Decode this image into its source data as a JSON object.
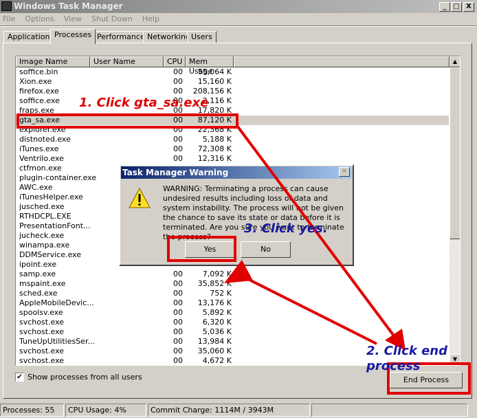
{
  "window": {
    "title": "Windows Task Manager",
    "minimize": "_",
    "maximize": "□",
    "close": "X"
  },
  "menu": [
    "File",
    "Options",
    "View",
    "Shut Down",
    "Help"
  ],
  "tabs": [
    {
      "label": "Applications"
    },
    {
      "label": "Processes",
      "active": true
    },
    {
      "label": "Performance"
    },
    {
      "label": "Networking"
    },
    {
      "label": "Users"
    }
  ],
  "columns": [
    "Image Name",
    "User Name",
    "CPU",
    "Mem Usage"
  ],
  "rows": [
    {
      "name": "soffice.bin",
      "cpu": "00",
      "mem": "55,064 K"
    },
    {
      "name": "Xion.exe",
      "cpu": "00",
      "mem": "15,160 K"
    },
    {
      "name": "firefox.exe",
      "cpu": "00",
      "mem": "208,156 K"
    },
    {
      "name": "soffice.exe",
      "cpu": "00",
      "mem": "2,116 K"
    },
    {
      "name": "fraps.exe",
      "cpu": "00",
      "mem": "17,820 K"
    },
    {
      "name": "gta_sa.exe",
      "cpu": "00",
      "mem": "87,120 K",
      "selected": true
    },
    {
      "name": "explorer.exe",
      "cpu": "00",
      "mem": "22,368 K"
    },
    {
      "name": "distnoted.exe",
      "cpu": "00",
      "mem": "5,188 K"
    },
    {
      "name": "iTunes.exe",
      "cpu": "00",
      "mem": "72,308 K"
    },
    {
      "name": "Ventrilo.exe",
      "cpu": "00",
      "mem": "12,316 K"
    },
    {
      "name": "ctfmon.exe"
    },
    {
      "name": "plugin-container.exe"
    },
    {
      "name": "AWC.exe"
    },
    {
      "name": "iTunesHelper.exe"
    },
    {
      "name": "jusched.exe"
    },
    {
      "name": "RTHDCPL.EXE"
    },
    {
      "name": "PresentationFont..."
    },
    {
      "name": "jucheck.exe"
    },
    {
      "name": "winampa.exe"
    },
    {
      "name": "DDMService.exe"
    },
    {
      "name": "ipoint.exe"
    },
    {
      "name": "samp.exe",
      "cpu": "00",
      "mem": "7,092 K"
    },
    {
      "name": "mspaint.exe",
      "cpu": "00",
      "mem": "35,852 K"
    },
    {
      "name": "sched.exe",
      "cpu": "00",
      "mem": "752 K"
    },
    {
      "name": "AppleMobileDevic...",
      "cpu": "00",
      "mem": "13,176 K"
    },
    {
      "name": "spoolsv.exe",
      "cpu": "00",
      "mem": "5,892 K"
    },
    {
      "name": "svchost.exe",
      "cpu": "00",
      "mem": "6,320 K"
    },
    {
      "name": "svchost.exe",
      "cpu": "00",
      "mem": "5,036 K"
    },
    {
      "name": "TuneUpUtilitiesSer...",
      "cpu": "00",
      "mem": "13,984 K"
    },
    {
      "name": "svchost.exe",
      "cpu": "00",
      "mem": "35,060 K"
    },
    {
      "name": "svchost.exe",
      "cpu": "00",
      "mem": "4,672 K"
    }
  ],
  "show_all_users": {
    "label": "Show processes from all users",
    "checked": true
  },
  "end_process_label": "End Process",
  "status": {
    "processes": "Processes: 55",
    "cpu": "CPU Usage: 4%",
    "commit": "Commit Charge: 1114M / 3943M"
  },
  "dialog": {
    "title": "Task Manager Warning",
    "message": "WARNING: Terminating a process can cause undesired results including loss of data and system instability. The process will not be given the chance to save its state or data before it is terminated.  Are you sure you want to terminate the process?",
    "yes": "Yes",
    "no": "No",
    "icon": "warning-icon"
  },
  "annotations": {
    "step1": "1. Click gta_sa.exe",
    "step2": "2. Click end process",
    "step3": "3. Click yes.",
    "red": "#e00000",
    "blue": "#1a1aa0"
  }
}
